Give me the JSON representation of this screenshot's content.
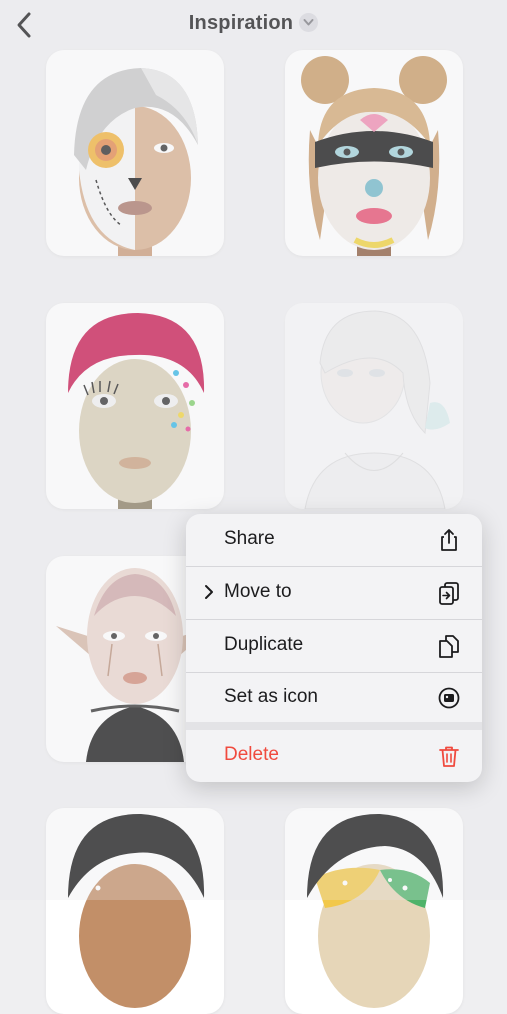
{
  "header": {
    "title": "Inspiration"
  },
  "menu": {
    "items": [
      {
        "label": "Share",
        "icon": "share-icon"
      },
      {
        "label": "Move to",
        "icon": "move-to-icon"
      },
      {
        "label": "Duplicate",
        "icon": "duplicate-icon"
      },
      {
        "label": "Set as icon",
        "icon": "set-as-icon-icon"
      },
      {
        "label": "Delete",
        "icon": "trash-icon"
      }
    ]
  },
  "colors": {
    "accent_red": "#f04a3e",
    "menu_bg": "#f3f3f5",
    "page_bg": "#efeff1"
  }
}
